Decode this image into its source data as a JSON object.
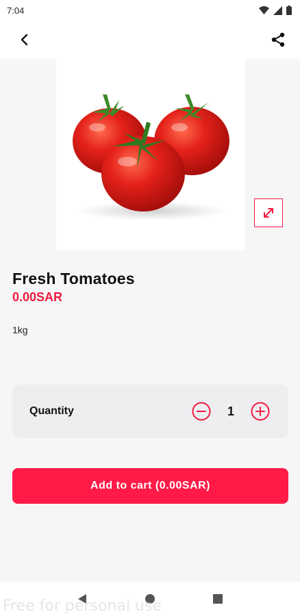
{
  "status_bar": {
    "time": "7:04",
    "icons": [
      "wifi-icon",
      "signal-icon",
      "battery-icon"
    ]
  },
  "app_bar": {
    "back_icon": "back-arrow-icon",
    "share_icon": "share-icon"
  },
  "product": {
    "image_alt": "tomatoes",
    "name": "Fresh Tomatoes",
    "price": "0.00SAR",
    "weight": "1kg"
  },
  "quantity": {
    "label": "Quantity",
    "value": "1"
  },
  "cart": {
    "add_label": "Add to cart (0.00SAR)"
  },
  "nav_bar": {
    "icons": [
      "back-triangle-icon",
      "home-circle-icon",
      "recents-square-icon"
    ]
  },
  "watermark": "Free for personal use",
  "colors": {
    "accent": "#f0183f",
    "button": "#ff1a47",
    "card": "#eeeef1",
    "background": "#f6f6f7"
  }
}
